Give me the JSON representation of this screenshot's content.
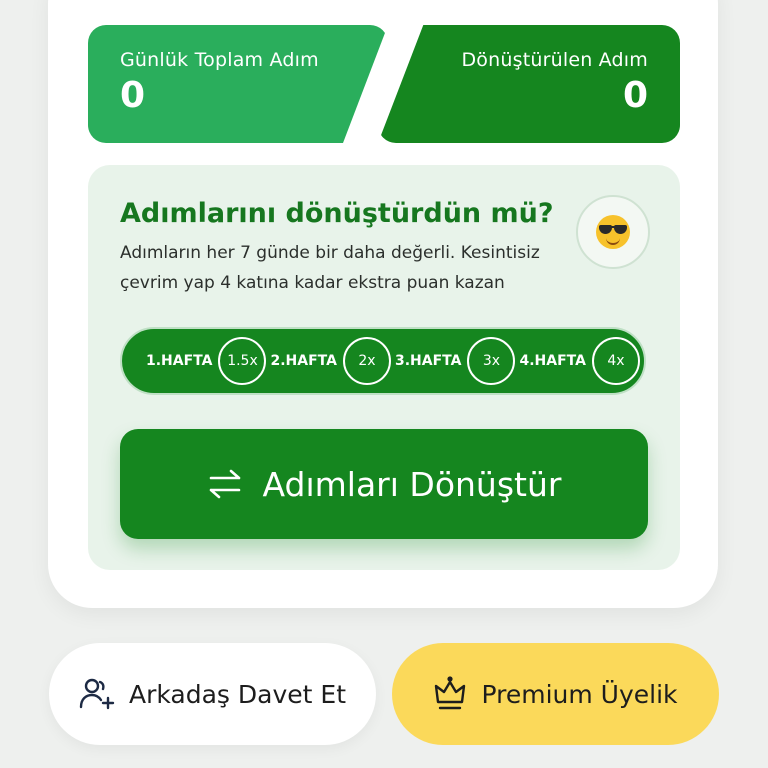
{
  "stats": {
    "daily_total_label": "Günlük Toplam Adım",
    "daily_total_value": "0",
    "converted_label": "Dönüştürülen Adım",
    "converted_value": "0"
  },
  "convert_panel": {
    "title": "Adımlarını dönüştürdün mü?",
    "description": "Adımların her 7 günde bir daha değerli. Kesintisiz çevrim yap 4 katına kadar ekstra puan kazan",
    "emoji": "smiling-face-with-sunglasses",
    "weeks": [
      {
        "label": "1.HAFTA",
        "multiplier": "1.5x"
      },
      {
        "label": "2.HAFTA",
        "multiplier": "2x"
      },
      {
        "label": "3.HAFTA",
        "multiplier": "3x"
      },
      {
        "label": "4.HAFTA",
        "multiplier": "4x"
      }
    ],
    "button_label": "Adımları Dönüştür"
  },
  "actions": {
    "invite_label": "Arkadaş Davet Et",
    "premium_label": "Premium Üyelik"
  },
  "colors": {
    "green_light": "#2aae5c",
    "green_dark": "#15861f",
    "panel_bg": "#e8f3ea",
    "premium_yellow": "#fbd95a"
  }
}
